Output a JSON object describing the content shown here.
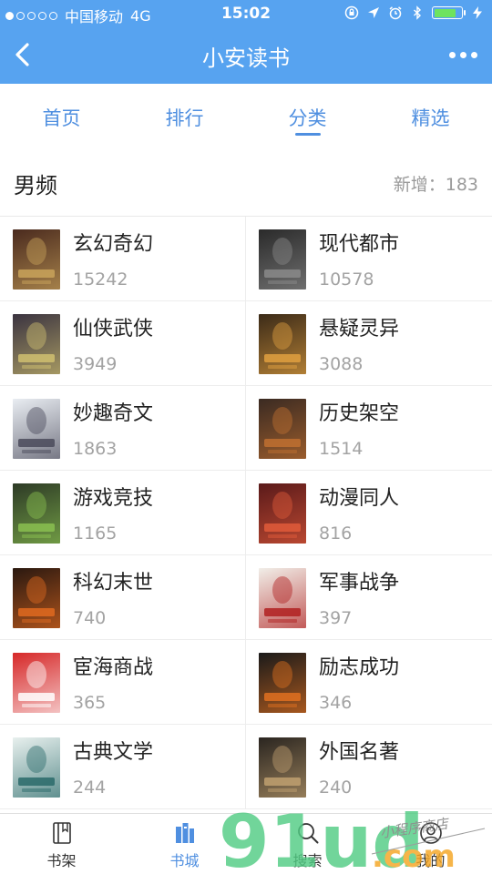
{
  "status_bar": {
    "carrier": "中国移动",
    "network": "4G",
    "time": "15:02",
    "signal_full": 1,
    "signal_total": 5
  },
  "nav": {
    "title": "小安读书",
    "back_icon": "chevron-left-icon",
    "more_icon": "more-dots-icon"
  },
  "tabs": [
    {
      "label": "首页",
      "active": false
    },
    {
      "label": "排行",
      "active": false
    },
    {
      "label": "分类",
      "active": true
    },
    {
      "label": "精选",
      "active": false
    }
  ],
  "section": {
    "title": "男频",
    "count_label": "新增：183"
  },
  "categories": [
    {
      "name": "玄幻奇幻",
      "count": "15242"
    },
    {
      "name": "现代都市",
      "count": "10578"
    },
    {
      "name": "仙侠武侠",
      "count": "3949"
    },
    {
      "name": "悬疑灵异",
      "count": "3088"
    },
    {
      "name": "妙趣奇文",
      "count": "1863"
    },
    {
      "name": "历史架空",
      "count": "1514"
    },
    {
      "name": "游戏竞技",
      "count": "1165"
    },
    {
      "name": "动漫同人",
      "count": "816"
    },
    {
      "name": "科幻末世",
      "count": "740"
    },
    {
      "name": "军事战争",
      "count": "397"
    },
    {
      "name": "宦海商战",
      "count": "365"
    },
    {
      "name": "励志成功",
      "count": "346"
    },
    {
      "name": "古典文学",
      "count": "244"
    },
    {
      "name": "外国名著",
      "count": "240"
    }
  ],
  "covers": [
    {
      "bg": "#4a2a1e",
      "fg": "#c9a35b"
    },
    {
      "bg": "#2a2a2a",
      "fg": "#8a8a8a"
    },
    {
      "bg": "#3a3340",
      "fg": "#d0c070"
    },
    {
      "bg": "#3b2a18",
      "fg": "#e0a040"
    },
    {
      "bg": "#e9edf2",
      "fg": "#4a4a5a"
    },
    {
      "bg": "#3a2a22",
      "fg": "#c07030"
    },
    {
      "bg": "#2d3a26",
      "fg": "#8ac050"
    },
    {
      "bg": "#5a1a1a",
      "fg": "#e05a3a"
    },
    {
      "bg": "#2a1810",
      "fg": "#e06a20"
    },
    {
      "bg": "#f1eee8",
      "fg": "#b02020"
    },
    {
      "bg": "#d62828",
      "fg": "#ffffff"
    },
    {
      "bg": "#1a1a1a",
      "fg": "#e07020"
    },
    {
      "bg": "#e8f0ee",
      "fg": "#2a6a6a"
    },
    {
      "bg": "#2a2520",
      "fg": "#c0a070"
    }
  ],
  "tabbar": [
    {
      "label": "书架",
      "icon": "bookshelf-icon",
      "active": false
    },
    {
      "label": "书城",
      "icon": "bookstore-icon",
      "active": true
    },
    {
      "label": "搜索",
      "icon": "search-icon",
      "active": false
    },
    {
      "label": "我的",
      "icon": "profile-icon",
      "active": false
    }
  ],
  "watermark": {
    "brand": "91ud",
    "suffix": ".com",
    "handwriting": "小程序商店"
  },
  "colors": {
    "header_bg": "#57a3f0",
    "accent": "#4f8fe0",
    "battery": "#6ee35e"
  }
}
